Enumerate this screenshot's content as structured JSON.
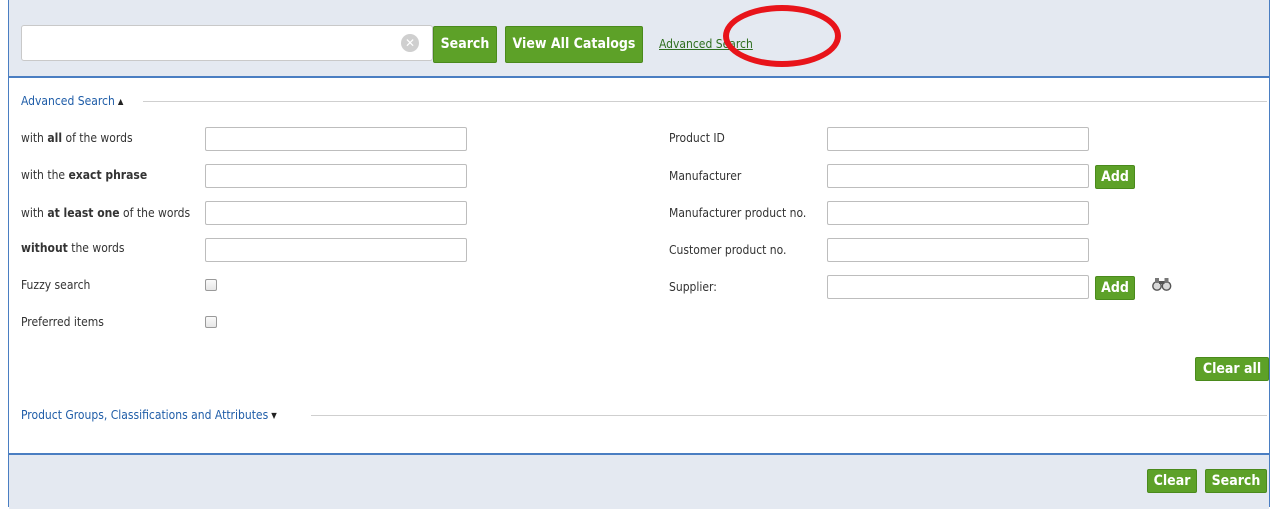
{
  "top": {
    "search_value": "",
    "search_label": "Search",
    "view_all_label": "View All Catalogs",
    "advanced_link": "Advanced Search"
  },
  "advanced": {
    "header": "Advanced Search",
    "left_rows": [
      {
        "pre": "with ",
        "bold": "all",
        "post": " of the words"
      },
      {
        "pre": "with the ",
        "bold": "exact phrase",
        "post": ""
      },
      {
        "pre": "with ",
        "bold": "at least one",
        "post": " of the words"
      },
      {
        "pre": "",
        "bold": "without",
        "post": " the words"
      }
    ],
    "fuzzy_label": "Fuzzy search",
    "preferred_label": "Preferred items",
    "right_labels": {
      "product_id": "Product ID",
      "manufacturer": "Manufacturer",
      "manufacturer_no": "Manufacturer product no.",
      "customer_no": "Customer product no.",
      "supplier": "Supplier:"
    },
    "add_label": "Add",
    "clear_all_label": "Clear all"
  },
  "groups": {
    "header": "Product Groups, Classifications and Attributes"
  },
  "bottom": {
    "clear_label": "Clear",
    "search_label": "Search"
  },
  "colors": {
    "accent_green": "#5da128",
    "link_blue": "#1f5da8",
    "border_blue": "#4a7ec2",
    "panel_bg": "#e4e9f1",
    "annotation_red": "#e8141a"
  },
  "icons": [
    "clear-search-icon",
    "caret-up-icon",
    "caret-down-icon",
    "binoculars-icon"
  ]
}
